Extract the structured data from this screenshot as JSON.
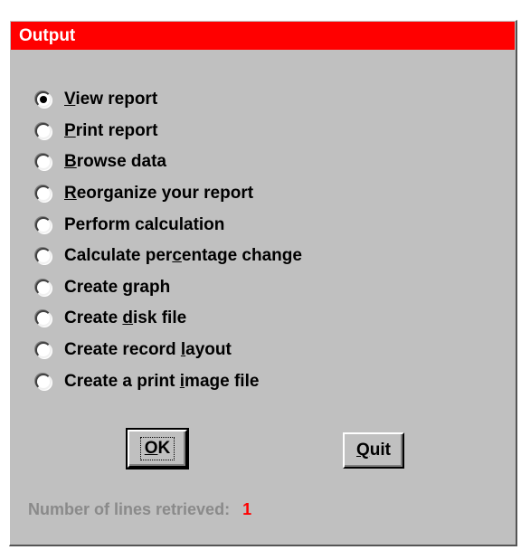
{
  "window": {
    "title": "Output"
  },
  "options": [
    {
      "label_pre": "",
      "mnemonic": "V",
      "label_post": "iew report",
      "checked": true
    },
    {
      "label_pre": "",
      "mnemonic": "P",
      "label_post": "rint report",
      "checked": false
    },
    {
      "label_pre": "",
      "mnemonic": "B",
      "label_post": "rowse data",
      "checked": false
    },
    {
      "label_pre": "",
      "mnemonic": "R",
      "label_post": "eorganize your report",
      "checked": false
    },
    {
      "label_pre": "Perform calculation",
      "mnemonic": "",
      "label_post": "",
      "checked": false
    },
    {
      "label_pre": "Calculate per",
      "mnemonic": "c",
      "label_post": "entage change",
      "checked": false
    },
    {
      "label_pre": "Create ",
      "mnemonic": "g",
      "label_post": "raph",
      "checked": false
    },
    {
      "label_pre": "Create ",
      "mnemonic": "d",
      "label_post": "isk file",
      "checked": false
    },
    {
      "label_pre": "Create record ",
      "mnemonic": "l",
      "label_post": "ayout",
      "checked": false
    },
    {
      "label_pre": "Create a print ",
      "mnemonic": "i",
      "label_post": "mage file",
      "checked": false
    }
  ],
  "buttons": {
    "ok_mnemonic": "O",
    "ok_rest": "K",
    "quit_mnemonic": "Q",
    "quit_rest": "uit"
  },
  "status": {
    "label": "Number of lines retrieved:",
    "count": "1"
  },
  "colors": {
    "titlebar": "#ff0000",
    "dialog_bg": "#c0c0c0",
    "status_label": "#8a8a8a",
    "status_count": "#ff0000"
  }
}
